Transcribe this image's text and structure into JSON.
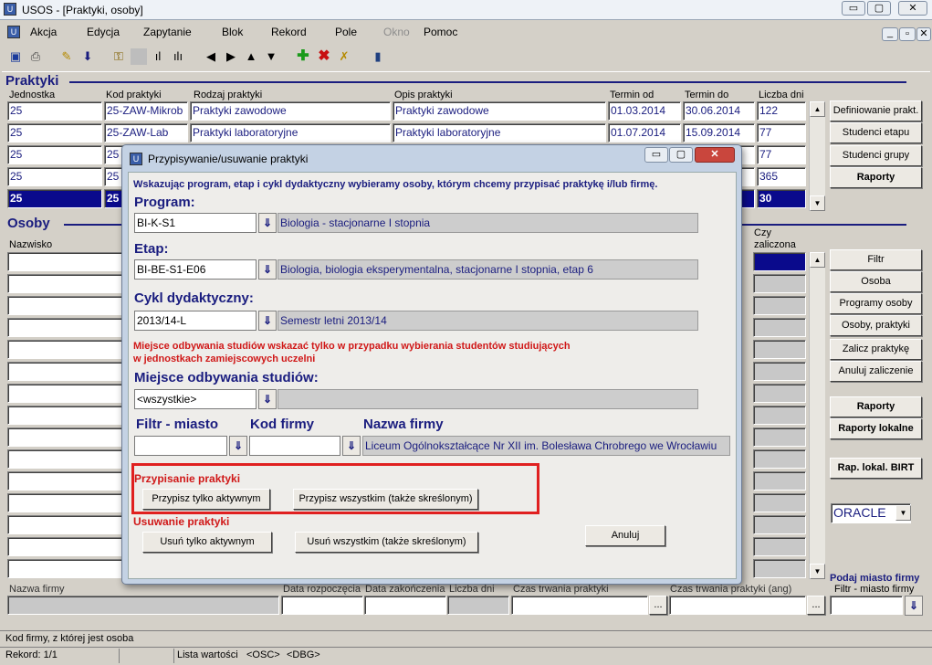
{
  "window": {
    "title": "USOS - [Praktyki, osoby]",
    "min": "▭",
    "max": "▢",
    "close": "✕",
    "doc_min": "_",
    "doc_max": "▫",
    "doc_close": "✕"
  },
  "menu": [
    "Akcja",
    "Edycja",
    "Zapytanie",
    "Blok",
    "Rekord",
    "Pole",
    "Okno",
    "Pomoc"
  ],
  "toolbar_icons": [
    "save-icon",
    "print-icon",
    "edit-icon",
    "download-icon",
    "search-key-icon",
    "blank-icon",
    "chart-icon",
    "bars-icon",
    "prev-icon",
    "next-icon",
    "up-icon",
    "down-icon",
    "add-icon",
    "delete-icon",
    "clear-icon",
    "exit-icon"
  ],
  "praktyki": {
    "title": "Praktyki",
    "columns": [
      "Jednostka",
      "Kod praktyki",
      "Rodzaj praktyki",
      "Opis praktyki",
      "Termin od",
      "Termin do",
      "Liczba dni"
    ],
    "rows": [
      [
        "25",
        "25-ZAW-Mikrob",
        "Praktyki zawodowe",
        "Praktyki zawodowe",
        "01.03.2014",
        "30.06.2014",
        "122"
      ],
      [
        "25",
        "25-ZAW-Lab",
        "Praktyki laboratoryjne",
        "Praktyki laboratoryjne",
        "01.07.2014",
        "15.09.2014",
        "77"
      ],
      [
        "25",
        "25",
        "",
        "",
        "",
        "",
        "77"
      ],
      [
        "25",
        "25",
        "",
        "",
        "",
        "",
        "365"
      ],
      [
        "25",
        "25",
        "",
        "",
        "",
        "",
        "30"
      ]
    ],
    "buttons": [
      "Definiowanie prakt.",
      "Studenci etapu",
      "Studenci grupy",
      "Raporty"
    ]
  },
  "osoby": {
    "title": "Osoby",
    "col_nazwisko": "Nazwisko",
    "col_czy": "Czy",
    "col_zaliczona": "zaliczona",
    "buttons": [
      "Filtr",
      "Osoba",
      "Programy osoby",
      "Osoby, praktyki",
      "Zalicz praktykę",
      "Anuluj zaliczenie"
    ],
    "buttons2": [
      "Raporty",
      "Raporty lokalne",
      "Rap. lokal. BIRT"
    ],
    "oracle": "ORACLE"
  },
  "bottom": {
    "nazwa_firmy": "Nazwa firmy",
    "data_rozp": "Data rozpoczęcia",
    "data_zak": "Data zakończenia",
    "liczba_dni": "Liczba dni",
    "czas": "Czas trwania praktyki",
    "czas_ang": "Czas trwania praktyki (ang)",
    "podaj": "Podaj miasto firmy",
    "filtr_miasto": "Filtr - miasto firmy",
    "dots": "..."
  },
  "status": {
    "hint": "Kod firmy, z której jest osoba",
    "rekord": "Rekord: 1/1",
    "lov": "Lista wartości",
    "osc": "<OSC>",
    "dbg": "<DBG>"
  },
  "dialog": {
    "title": "Przypisywanie/usuwanie praktyki",
    "instruction": "Wskazując program, etap i cykl dydaktyczny wybieramy osoby, którym chcemy przypisać praktykę i/lub firmę.",
    "program_label": "Program:",
    "program_code": "BI-K-S1",
    "program_name": "Biologia - stacjonarne I stopnia",
    "etap_label": "Etap:",
    "etap_code": "BI-BE-S1-E06",
    "etap_name": "Biologia, biologia eksperymentalna, stacjonarne I stopnia, etap 6",
    "cykl_label": "Cykl dydaktyczny:",
    "cykl_code": "2013/14-L",
    "cykl_name": "Semestr letni 2013/14",
    "warning1": "Miejsce odbywania studiów wskazać tylko w przypadku wybierania studentów studiujących",
    "warning2": "w jednostkach zamiejscowych uczelni",
    "miejsce_label": "Miejsce odbywania studiów:",
    "miejsce_value": "<wszystkie>",
    "filtr_label": "Filtr - miasto",
    "kod_label": "Kod firmy",
    "nazwa_label": "Nazwa firmy",
    "nazwa_value": "Liceum Ogólnokształcące Nr XII im. Bolesława Chrobrego we Wrocławiu",
    "przyp_title": "Przypisanie praktyki",
    "przyp_aktywnym": "Przypisz tylko aktywnym",
    "przyp_wszystkim": "Przypisz wszystkim (także skreślonym)",
    "usun_title": "Usuwanie praktyki",
    "usun_aktywnym": "Usuń tylko aktywnym",
    "usun_wszystkim": "Usuń wszystkim (także skreślonym)",
    "anuluj": "Anuluj",
    "lov_glyph": "⇓"
  }
}
